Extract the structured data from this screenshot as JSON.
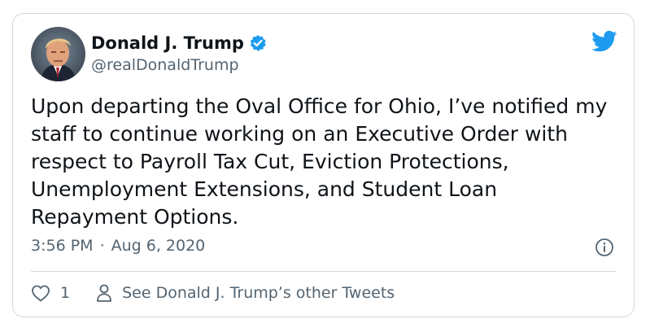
{
  "user": {
    "display_name": "Donald J. Trump",
    "handle": "@realDonaldTrump",
    "verified": true,
    "avatar_icon": "profile-photo"
  },
  "tweet": {
    "text": "Upon departing the Oval Office for Ohio, I’ve notified my staff to continue working on an Executive Order with respect to Payroll Tax Cut, Eviction Protections, Unemployment Extensions, and Student Loan Repayment Options.",
    "time": "3:56 PM",
    "separator": "·",
    "date": "Aug 6, 2020"
  },
  "actions": {
    "like_count": "1",
    "other_tweets_label": "See Donald J. Trump’s other Tweets"
  },
  "colors": {
    "twitter_blue": "#1d9bf0",
    "text_primary": "#0f1419",
    "text_secondary": "#536471",
    "border": "#cfd9de"
  }
}
